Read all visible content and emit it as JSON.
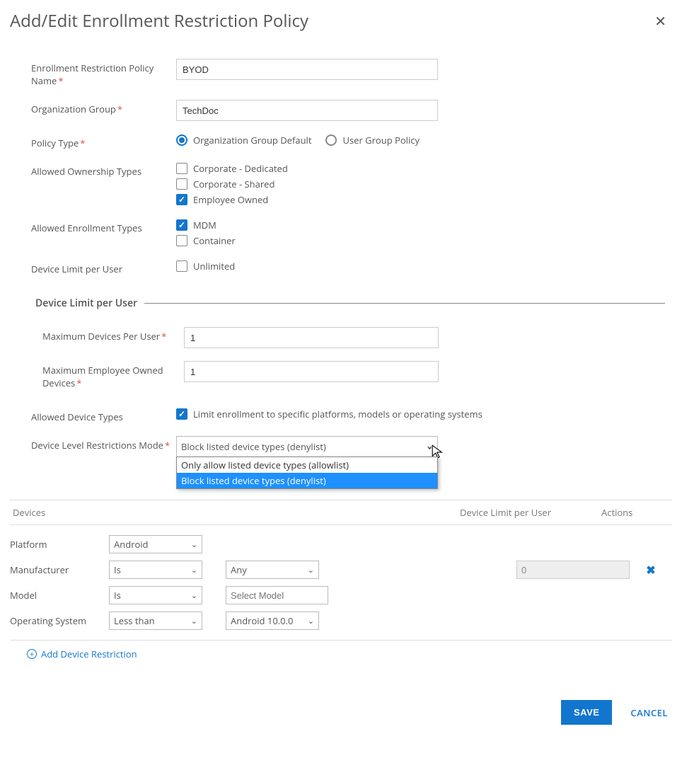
{
  "header": {
    "title": "Add/Edit Enrollment Restriction Policy"
  },
  "fields": {
    "policyName": {
      "label": "Enrollment Restriction Policy Name",
      "value": "BYOD"
    },
    "orgGroup": {
      "label": "Organization Group",
      "value": "TechDoc"
    },
    "policyType": {
      "label": "Policy Type",
      "options": {
        "orgDefault": "Organization Group Default",
        "userGroup": "User Group Policy"
      },
      "selected": "orgDefault"
    },
    "ownershipTypes": {
      "label": "Allowed Ownership Types",
      "items": [
        {
          "key": "corpDedicated",
          "label": "Corporate - Dedicated",
          "checked": false
        },
        {
          "key": "corpShared",
          "label": "Corporate - Shared",
          "checked": false
        },
        {
          "key": "employeeOwned",
          "label": "Employee Owned",
          "checked": true
        }
      ]
    },
    "enrollmentTypes": {
      "label": "Allowed Enrollment Types",
      "items": [
        {
          "key": "mdm",
          "label": "MDM",
          "checked": true
        },
        {
          "key": "container",
          "label": "Container",
          "checked": false
        }
      ]
    },
    "deviceLimitUnlimited": {
      "label": "Device Limit per User",
      "option": "Unlimited",
      "checked": false
    }
  },
  "section": {
    "title": "Device Limit per User",
    "maxDevices": {
      "label": "Maximum Devices Per User",
      "value": "1"
    },
    "maxEmployeeOwned": {
      "label": "Maximum Employee Owned Devices",
      "value": "1"
    }
  },
  "allowedDeviceTypes": {
    "label": "Allowed Device Types",
    "checkboxLabel": "Limit enrollment to specific platforms, models or operating systems",
    "checked": true
  },
  "restrictionsMode": {
    "label": "Device Level Restrictions Mode",
    "selected": "Block listed device types (denylist)",
    "options": [
      "Only allow listed device types (allowlist)",
      "Block listed device types (denylist)"
    ]
  },
  "devicesTable": {
    "headers": {
      "devices": "Devices",
      "limit": "Device Limit per User",
      "actions": "Actions"
    },
    "row": {
      "platform": {
        "label": "Platform",
        "value": "Android"
      },
      "manufacturer": {
        "label": "Manufacturer",
        "op": "Is",
        "val": "Any"
      },
      "model": {
        "label": "Model",
        "op": "Is",
        "placeholder": "Select Model"
      },
      "os": {
        "label": "Operating System",
        "op": "Less than",
        "val": "Android 10.0.0"
      },
      "limit": "0"
    },
    "addLink": "Add Device Restriction"
  },
  "footer": {
    "save": "SAVE",
    "cancel": "CANCEL"
  }
}
